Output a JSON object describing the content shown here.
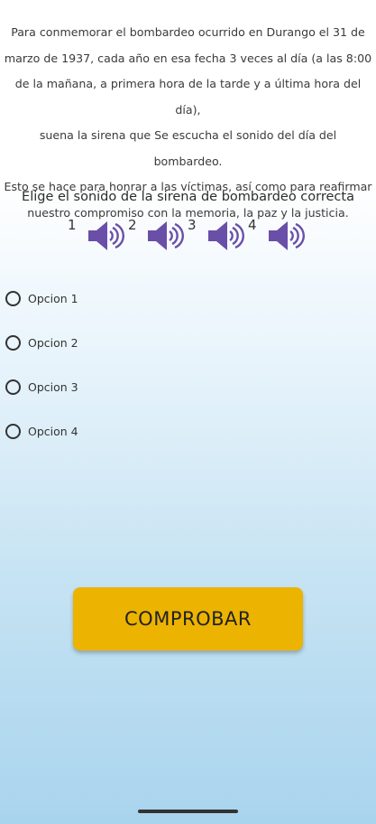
{
  "intro_lines": [
    "Para conmemorar el bombardeo ocurrido en Durango el 31 de",
    "marzo de 1937, cada año en esa fecha 3 veces al día (a las 8:00",
    "de la mañana, a primera hora de la tarde y a última hora del día),",
    "suena la sirena que Se escucha el sonido del día del bombardeo.",
    "Esto se hace para honrar a las víctimas, así como para reafirmar",
    "nuestro compromiso con la memoria, la paz y la justicia."
  ],
  "question": "Elige el sonido de la sirena de bombardeo correcta",
  "sounds": [
    {
      "number": "1",
      "icon": "speaker-icon"
    },
    {
      "number": "2",
      "icon": "speaker-icon"
    },
    {
      "number": "3",
      "icon": "speaker-icon"
    },
    {
      "number": "4",
      "icon": "speaker-icon"
    }
  ],
  "options": [
    "Opcion 1",
    "Opcion 2",
    "Opcion 3",
    "Opcion 4"
  ],
  "check_button": "COMPROBAR",
  "colors": {
    "speaker": "#6a4fa8",
    "button": "#ecb300"
  }
}
